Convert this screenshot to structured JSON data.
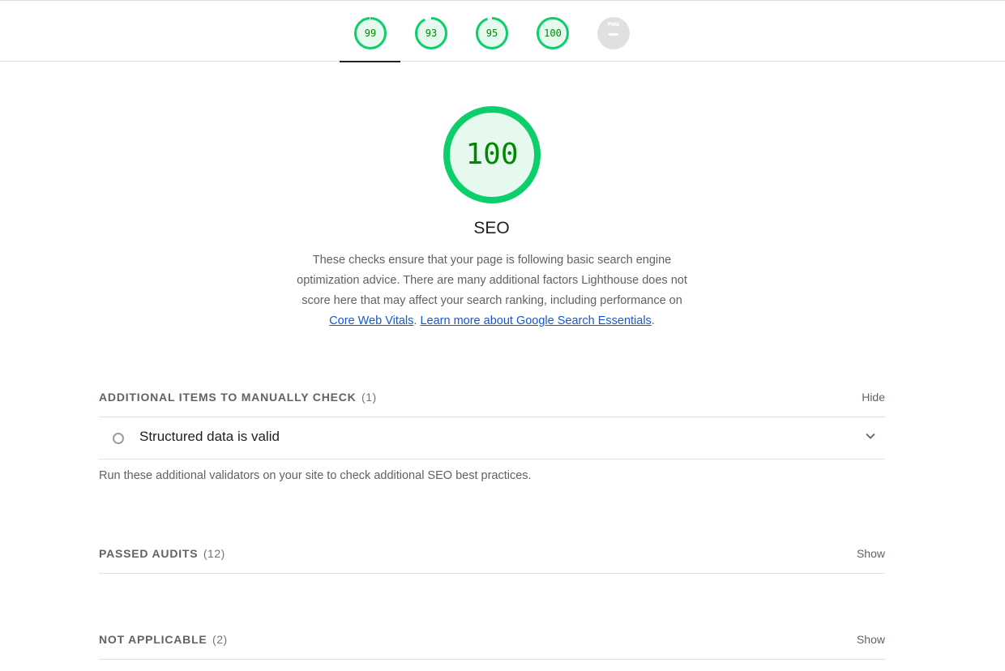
{
  "tabs": [
    {
      "score": "99",
      "fraction": 0.99
    },
    {
      "score": "93",
      "fraction": 0.93
    },
    {
      "score": "95",
      "fraction": 0.95
    },
    {
      "score": "100",
      "fraction": 1.0
    }
  ],
  "pwa_tab": {
    "label": "PWA",
    "value": "—"
  },
  "category": {
    "score": "100",
    "fraction": 1.0,
    "title": "SEO",
    "description_before": "These checks ensure that your page is following basic search engine optimization advice. There are many additional factors Lighthouse does not score here that may affect your search ranking, including performance on ",
    "link1": "Core Web Vitals",
    "sep": ". ",
    "link2": "Learn more about Google Search Essentials",
    "description_after": "."
  },
  "manual": {
    "title": "ADDITIONAL ITEMS TO MANUALLY CHECK",
    "count": "(1)",
    "toggle": "Hide",
    "audit": "Structured data is valid",
    "note": "Run these additional validators on your site to check additional SEO best practices."
  },
  "passed": {
    "title": "PASSED AUDITS",
    "count": "(12)",
    "toggle": "Show"
  },
  "not_applicable": {
    "title": "NOT APPLICABLE",
    "count": "(2)",
    "toggle": "Show"
  },
  "colors": {
    "pass": "#0cce6b",
    "pass_fill": "#e6f9ef",
    "pass_text": "#008800",
    "na": "#e0e0e0"
  }
}
